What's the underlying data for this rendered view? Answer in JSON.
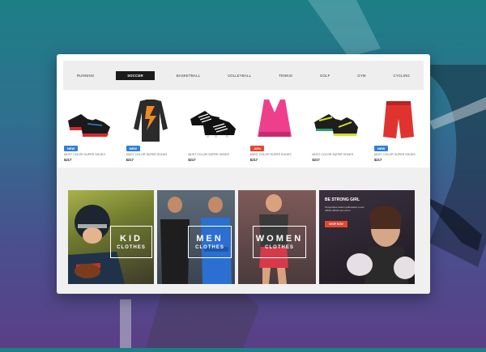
{
  "tabs": [
    "RUNNING",
    "SOCCER",
    "BASKETBALL",
    "VOLLEYBALL",
    "TENNIS",
    "GOLF",
    "GYM",
    "CYCLING"
  ],
  "active_tab": "SOCCER",
  "products": [
    {
      "badge": "NEW",
      "badge_color": "#2f7fd6",
      "name": "MUST COLOR SUPER SHOES",
      "price": "$217",
      "icon": "red-black-sneaker"
    },
    {
      "badge": "NEW",
      "badge_color": "#2f7fd6",
      "name": "MUST COLOR SUPER SHOES",
      "price": "$217",
      "icon": "black-orange-long-sleeve-shirt"
    },
    {
      "badge": "",
      "badge_color": "",
      "name": "MUST COLOR SUPER SHOES",
      "price": "$217",
      "icon": "black-soccer-cleats"
    },
    {
      "badge": "-30%",
      "badge_color": "#e8452c",
      "name": "MUST COLOR SUPER SHOES",
      "price": "$217",
      "icon": "pink-sports-bra"
    },
    {
      "badge": "",
      "badge_color": "",
      "name": "MUST COLOR SUPER SHOES",
      "price": "$217",
      "icon": "yellow-black-sneaker"
    },
    {
      "badge": "NEW",
      "badge_color": "#2f7fd6",
      "name": "MUST COLOR SUPER SHOES",
      "price": "$217",
      "icon": "red-shorts"
    }
  ],
  "banners": {
    "kid": {
      "big": "KID",
      "small": "CLOTHES"
    },
    "men": {
      "big": "MEN",
      "small": "CLOTHES"
    },
    "women": {
      "big": "WOMEN",
      "small": "CLOTHES"
    },
    "strong": {
      "title": "BE STRONG GIRL",
      "text": "Temporibus autem quibusdam et aut officiis debitis aut rerum",
      "button": "SHOP NOW"
    }
  },
  "colors": {
    "accent": "#e8452c",
    "new_badge": "#2f7fd6",
    "active_tab_bg": "#1b1b1b"
  }
}
